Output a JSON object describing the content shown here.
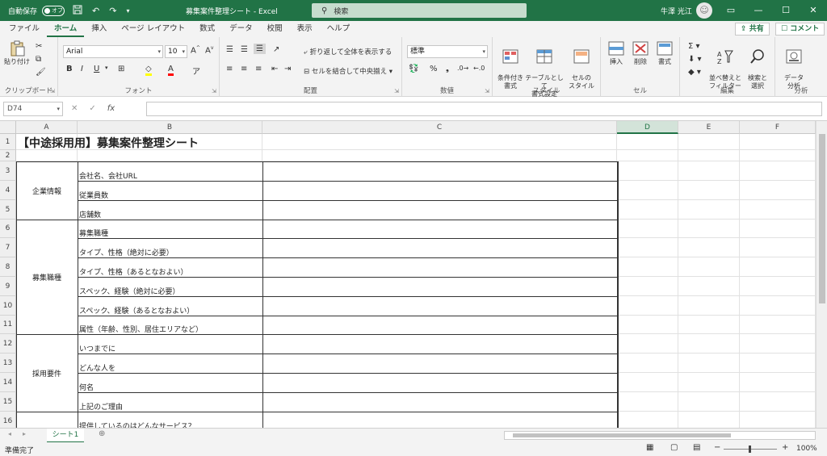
{
  "window": {
    "autosave_label": "自動保存",
    "autosave_state": "オフ",
    "title": "募集案件整理シート  -  Excel",
    "search_placeholder": "検索",
    "user_name": "牛澤 光江"
  },
  "ribbon_tabs": [
    "ファイル",
    "ホーム",
    "挿入",
    "ページ レイアウト",
    "数式",
    "データ",
    "校閲",
    "表示",
    "ヘルプ"
  ],
  "share_label": "共有",
  "comment_label": "コメント",
  "ribbon": {
    "clipboard": {
      "paste": "貼り付け",
      "label": "クリップボード"
    },
    "font": {
      "name": "Arial",
      "size": "10",
      "label": "フォント"
    },
    "alignment": {
      "wrap": "折り返して全体を表示する",
      "merge": "セルを結合して中央揃え",
      "label": "配置"
    },
    "number": {
      "format": "標準",
      "label": "数値"
    },
    "styles": {
      "conditional": "条件付き\n書式",
      "table": "テーブルとして\n書式設定",
      "cell": "セルの\nスタイル",
      "label": "スタイル"
    },
    "cells": {
      "insert": "挿入",
      "delete": "削除",
      "format": "書式",
      "label": "セル"
    },
    "editing": {
      "sort": "並べ替えと\nフィルター",
      "find": "検索と\n選択",
      "label": "編集"
    },
    "analysis": {
      "data": "データ\n分析",
      "label": "分析"
    }
  },
  "formula_bar": {
    "name_box": "D74",
    "formula": ""
  },
  "columns": [
    "A",
    "B",
    "C",
    "D",
    "E",
    "F"
  ],
  "rows": [
    "1",
    "2",
    "3",
    "4",
    "5",
    "6",
    "7",
    "8",
    "9",
    "10",
    "11",
    "12",
    "13",
    "14",
    "15",
    "16"
  ],
  "sheet": {
    "title": "【中途採用用】募集案件整理シート",
    "groups": [
      {
        "label": "企業情報",
        "items": [
          "会社名、会社URL",
          "従業員数",
          "店舗数"
        ]
      },
      {
        "label": "募集職種",
        "items": [
          "募集職種",
          "タイプ、性格（絶対に必要）",
          "タイプ、性格（あるとなおよい）",
          "スペック、経験（絶対に必要）",
          "スペック、経験（あるとなおよい）",
          "属性（年齢、性別、居住エリアなど）"
        ]
      },
      {
        "label": "採用要件",
        "items": [
          "いつまでに",
          "どんな人を",
          "何名",
          "上記のご理由"
        ]
      },
      {
        "label": "",
        "items": [
          "提供しているのはどんなサービス？"
        ]
      }
    ]
  },
  "sheet_tabs": [
    "シート1"
  ],
  "status": {
    "ready": "準備完了",
    "zoom": "100%"
  },
  "colors": {
    "accent": "#217346"
  }
}
